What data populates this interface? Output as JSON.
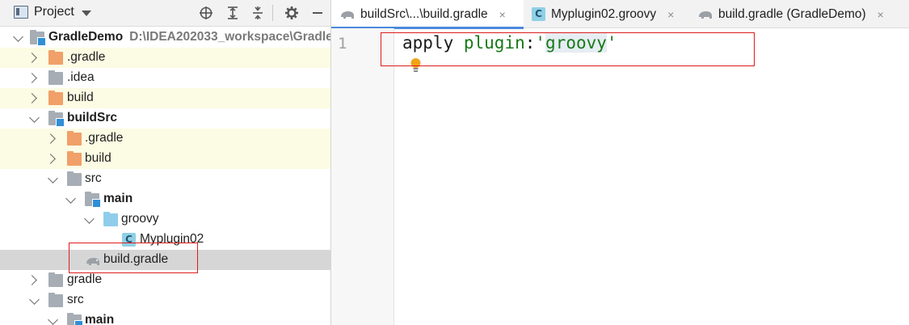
{
  "project_panel": {
    "title": "Project",
    "toolbar": {
      "locate_icon": "crosshair-icon",
      "expand_icon": "expand-all-icon",
      "collapse_icon": "collapse-all-icon",
      "settings_icon": "gear-icon",
      "hide_icon": "minimize-icon"
    }
  },
  "tree": {
    "root": {
      "name": "GradleDemo",
      "path": "D:\\IDEA202033_workspace\\Gradle"
    },
    "items": [
      {
        "label": ".gradle"
      },
      {
        "label": ".idea"
      },
      {
        "label": "build"
      },
      {
        "label": "buildSrc"
      },
      {
        "label": ".gradle"
      },
      {
        "label": "build"
      },
      {
        "label": "src"
      },
      {
        "label": "main"
      },
      {
        "label": "groovy"
      },
      {
        "label": "Myplugin02"
      },
      {
        "label": "build.gradle"
      },
      {
        "label": "gradle"
      },
      {
        "label": "src"
      },
      {
        "label": "main"
      }
    ]
  },
  "tabs": [
    {
      "label": "buildSrc\\...\\build.gradle"
    },
    {
      "label": "Myplugin02.groovy"
    },
    {
      "label": "build.gradle (GradleDemo)"
    }
  ],
  "tab_close_glyph": "×",
  "groovy_badge": "C",
  "editor": {
    "line_number": "1",
    "code": {
      "keyword": "apply",
      "plugin": "plugin",
      "colon": ":",
      "quote_open": "'",
      "word": "groovy",
      "quote_close": "'"
    }
  },
  "colors": {
    "selection": "#d6d6d6",
    "excluded_bg": "#fcfbe3",
    "highlight_border": "#dd1c1c",
    "string_green": "#177a17",
    "tab_active_underline": "#4a89dc"
  }
}
